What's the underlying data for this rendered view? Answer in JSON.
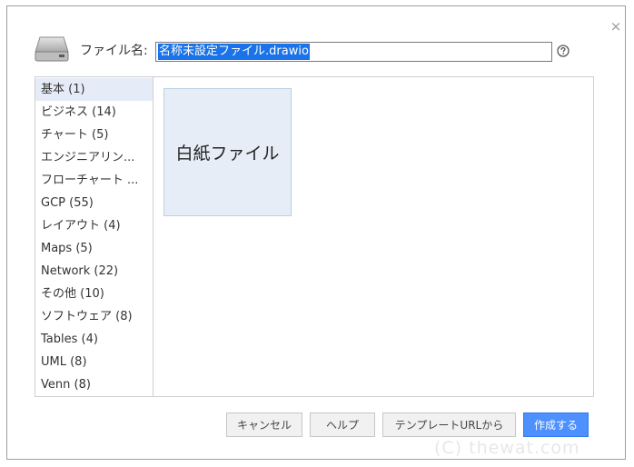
{
  "dialog": {
    "close_symbol": "×",
    "filename_label": "ファイル名:",
    "filename_value": "名称未設定ファイル.drawio",
    "help_icon": "question-circle-icon",
    "drive_icon": "hard-drive-icon"
  },
  "categories": [
    {
      "label": "基本 (1)",
      "selected": true
    },
    {
      "label": "ビジネス (14)"
    },
    {
      "label": "チャート (5)"
    },
    {
      "label": "エンジニアリン..."
    },
    {
      "label": "フローチャート ..."
    },
    {
      "label": "GCP (55)"
    },
    {
      "label": "レイアウト (4)"
    },
    {
      "label": "Maps (5)"
    },
    {
      "label": "Network (22)"
    },
    {
      "label": "その他 (10)"
    },
    {
      "label": "ソフトウェア (8)"
    },
    {
      "label": "Tables (4)"
    },
    {
      "label": "UML (8)"
    },
    {
      "label": "Venn (8)"
    }
  ],
  "templates": [
    {
      "label": "白紙ファイル"
    }
  ],
  "buttons": {
    "cancel": "キャンセル",
    "help": "ヘルプ",
    "template_url": "テンプレートURLから",
    "create": "作成する"
  },
  "colors": {
    "primary_button": "#4d90fe",
    "selected_category": "#e6ecf7",
    "tile_background": "#e6edf7",
    "selection_highlight": "#1a73e8"
  },
  "watermark": "(C) thewat.com"
}
